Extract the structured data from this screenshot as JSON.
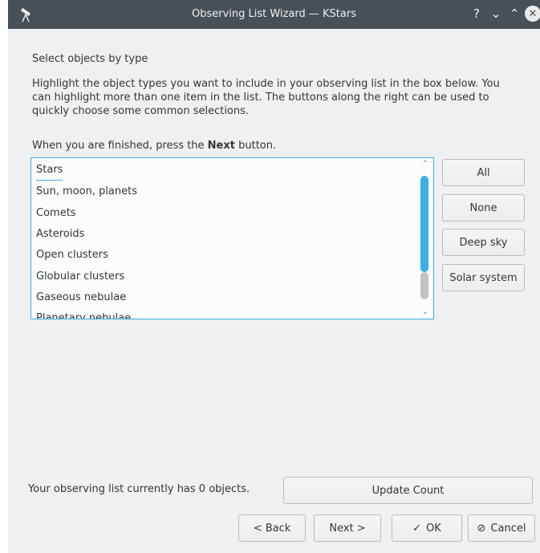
{
  "window": {
    "title": "Observing List Wizard — KStars",
    "help_glyph": "?",
    "minimize_glyph": "⌄",
    "maximize_glyph": "⌃",
    "close_glyph": "✕"
  },
  "page": {
    "heading": "Select objects by type",
    "paragraph": "Highlight the object types you want to include in your observing list in the box below. You can highlight more than one item in the list. The buttons along the right can be used to quickly choose some common selections.",
    "finished_prefix": "When you are finished, press the ",
    "finished_bold": "Next",
    "finished_suffix": " button."
  },
  "object_types": [
    "Stars",
    "Sun, moon, planets",
    "Comets",
    "Asteroids",
    "Open clusters",
    "Globular clusters",
    "Gaseous nebulae",
    "Planetary nebulae"
  ],
  "selection_buttons": {
    "all": "All",
    "none": "None",
    "deep_sky": "Deep sky",
    "solar_system": "Solar system"
  },
  "count": {
    "text": "Your observing list currently has 0 objects.",
    "update_button": "Update Count"
  },
  "footer": {
    "back": "< Back",
    "next": "Next >",
    "ok": "OK",
    "ok_icon": "✓",
    "cancel": "Cancel",
    "cancel_icon": "⊘"
  },
  "scrollbar": {
    "up": "⌃",
    "down": "⌄"
  },
  "colors": {
    "titlebar": "#475057",
    "accent": "#3daee9",
    "dialog_bg": "#eff0f1"
  }
}
